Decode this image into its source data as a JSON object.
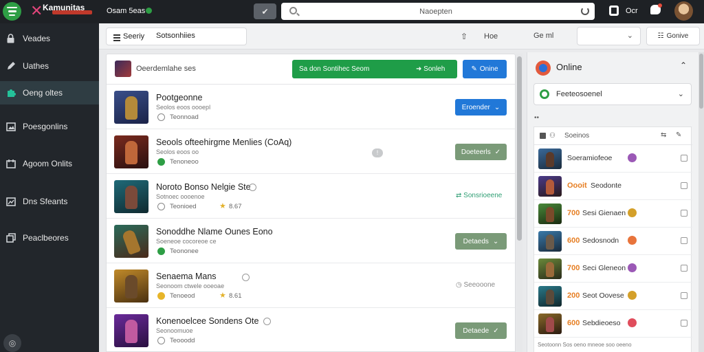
{
  "topbar": {
    "brand_name": "Kamunitas",
    "user_name": "Osam 5eas",
    "search_placeholder": "Naoepten",
    "label_right": "Ocr"
  },
  "sidebar": {
    "items": [
      {
        "label": "Veades",
        "icon": "lock-icon"
      },
      {
        "label": "Uathes",
        "icon": "pen-icon"
      },
      {
        "label": "Oeng oltes",
        "icon": "puzzle-icon",
        "active": true
      },
      {
        "label": "Poesgonlins",
        "icon": "image-icon"
      },
      {
        "label": "Agoom Onlits",
        "icon": "calendar-icon"
      },
      {
        "label": "Dns Sfeants",
        "icon": "chart-icon"
      },
      {
        "label": "Peaclbeores",
        "icon": "layers-icon"
      }
    ]
  },
  "toolbar": {
    "menu_label": "Seeriy",
    "menu_label_2": "Sotsonhiies",
    "text1": "Hoe",
    "text2": "Ge ml",
    "button_label": "Gonive"
  },
  "list": {
    "head_label": "Oeerdemlahe ses",
    "green_btn_left": "Sa don Sontihec Seom",
    "green_btn_right": "Sonleh",
    "blue_btn": "Onine",
    "rows": [
      {
        "title": "Pootgeonne",
        "sub": "Seolos eoos oooepl",
        "status": "Teonnoad",
        "rating": "",
        "action": "Eroender",
        "action_type": "blue"
      },
      {
        "title": "Seools ofteehirgme Menlies (CoAq)",
        "sub": "Seolos eoos oo",
        "status": "Tenoneoo",
        "rating": "",
        "action": "Doeteerls",
        "action_type": "grey"
      },
      {
        "title": "Noroto Bonso Nelgie Ste",
        "sub": "Sotnoec oooenoe",
        "status": "Teonioed",
        "rating": "8.67",
        "action": "Sonsrioeene",
        "action_type": "link"
      },
      {
        "title": "Sonoddhe Nlame Ounes Eono",
        "sub": "Soeneoe cocoreoe ce",
        "status": "Teononee",
        "rating": "",
        "action": "Detaeds",
        "action_type": "grey"
      },
      {
        "title": "Senaema Mans",
        "sub": "Seonoom ctwele ooeoae",
        "status": "Tenoeod",
        "rating": "8.61",
        "action": "Seeooone",
        "action_type": "muted"
      },
      {
        "title": "Konenoelcee Sondens Ote",
        "sub": "Seonoomuoe",
        "status": "Teooodd",
        "rating": "",
        "action": "Detaede",
        "action_type": "grey"
      }
    ]
  },
  "right_panel": {
    "title": "Online",
    "select_label": "Feeteosoenel",
    "mini_label": "••",
    "table_header": "Soeinos",
    "rows": [
      {
        "num": "",
        "label": "Soeramiofeoe",
        "badge": "#9b59b6"
      },
      {
        "num": "Oooit",
        "label": "Seodonte",
        "badge": ""
      },
      {
        "num": "700",
        "label": "Sesi Gienaen",
        "badge": "#d4a02a"
      },
      {
        "num": "600",
        "label": "Sedosnodn",
        "badge": "#e8743b"
      },
      {
        "num": "700",
        "label": "Seci Gleneon",
        "badge": "#9b59b6"
      },
      {
        "num": "200",
        "label": "Seot Oovese",
        "badge": "#d4a02a"
      },
      {
        "num": "600",
        "label": "Sebdieoeso",
        "badge": "#e04d5c"
      }
    ],
    "footer": "Seotoonn Sos oeno mneoe soo oeeno"
  }
}
